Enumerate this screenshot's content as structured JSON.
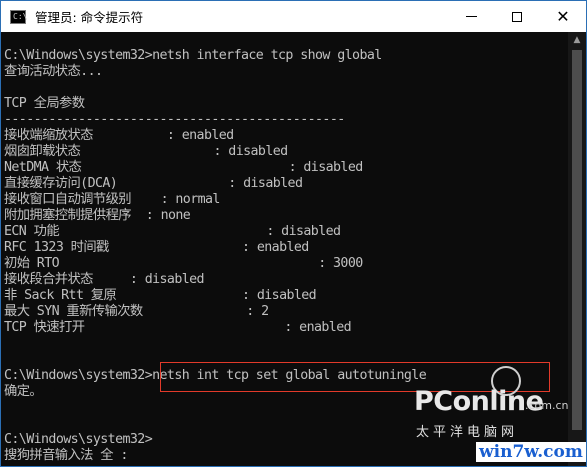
{
  "window": {
    "title": "管理员: 命令提示符",
    "icon": "terminal-icon"
  },
  "controls": {
    "close_glyph": "✕",
    "icons": [
      "minimize-icon",
      "maximize-icon",
      "close-icon"
    ]
  },
  "console": {
    "lines": [
      "",
      "C:\\Windows\\system32>netsh interface tcp show global",
      "查询活动状态...",
      "",
      "TCP 全局参数",
      "----------------------------------------------",
      "接收端缩放状态          : enabled",
      "烟囱卸载状态                  : disabled",
      "NetDMA 状态                            : disabled",
      "直接缓存访问(DCA)               : disabled",
      "接收窗口自动调节级别    : normal",
      "附加拥塞控制提供程序  : none",
      "ECN 功能                            : disabled",
      "RFC 1323 时间戳                  : enabled",
      "初始 RTO                                   : 3000",
      "接收段合并状态     : disabled",
      "非 Sack Rtt 复原                 : disabled",
      "最大 SYN 重新传输次数              : 2",
      "TCP 快速打开                           : enabled",
      "",
      "",
      "C:\\Windows\\system32>netsh int tcp set global autotuningle",
      "确定。",
      "",
      "",
      "C:\\Windows\\system32>",
      "搜狗拼音输入法 全 :"
    ]
  },
  "scrollbar": {
    "up_glyph": "▲",
    "down_glyph": "▼"
  },
  "watermark": {
    "brand": "PConline",
    "com": ".com.cn",
    "cn": "太平洋电脑网",
    "url": "win7w.com"
  }
}
